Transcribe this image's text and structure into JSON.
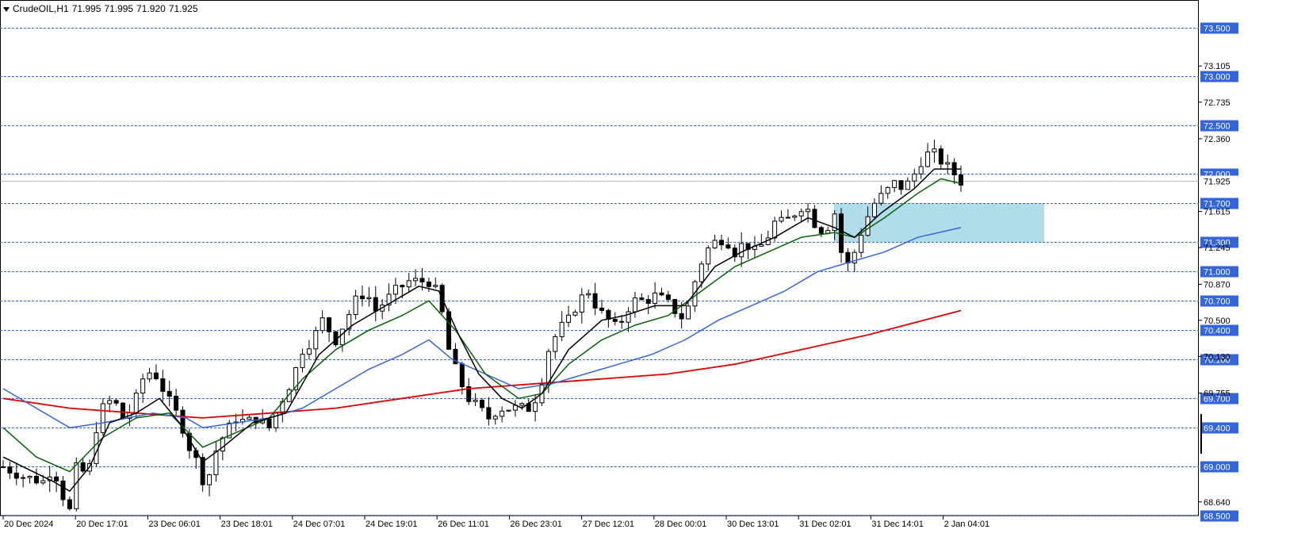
{
  "header": {
    "symbol": "CrudeOIL,H1",
    "open": "71.995",
    "high": "71.995",
    "low": "71.920",
    "close": "71.925"
  },
  "colors": {
    "ema_fast": "#000000",
    "ema_mid": "#006400",
    "ema_slow": "#3366dd",
    "ema_long": "#e00000",
    "zone": "#a8d8e8",
    "level_line": "#3366dd",
    "candle_up": "#ffffff",
    "candle_down": "#000000",
    "label_bg": "#3366dd"
  },
  "chart_data": {
    "type": "candlestick",
    "timeframe": "H1",
    "y_range": [
      68.5,
      73.7
    ],
    "y_ticks": [
      "73.105",
      "72.735",
      "72.360",
      "71.615",
      "71.245",
      "70.870",
      "70.500",
      "70.130",
      "69.755",
      "68.640"
    ],
    "level_labels": [
      "73.500",
      "73.000",
      "72.500",
      "72.000",
      "71.700",
      "71.300",
      "71.000",
      "70.700",
      "70.400",
      "70.100",
      "69.700",
      "69.400",
      "69.000",
      "68.500"
    ],
    "current_price": "71.925",
    "zone": {
      "from": 71.3,
      "to": 71.7
    },
    "x_labels": [
      "20 Dec 2024",
      "20 Dec 17:01",
      "23 Dec 06:01",
      "23 Dec 18:01",
      "24 Dec 07:01",
      "24 Dec 19:01",
      "26 Dec 11:01",
      "26 Dec 23:01",
      "27 Dec 12:01",
      "28 Dec 00:01",
      "30 Dec 13:01",
      "31 Dec 02:01",
      "31 Dec 14:01",
      "2 Jan 04:01"
    ],
    "close_path": [
      [
        0,
        69.0
      ],
      [
        6,
        68.9
      ],
      [
        12,
        68.85
      ],
      [
        15,
        69.0
      ],
      [
        18,
        68.7
      ],
      [
        20,
        68.55
      ],
      [
        23,
        69.2
      ],
      [
        25,
        68.7
      ],
      [
        27,
        69.3
      ],
      [
        30,
        69.6
      ],
      [
        33,
        69.7
      ],
      [
        36,
        69.5
      ],
      [
        39,
        69.6
      ],
      [
        42,
        69.9
      ],
      [
        45,
        70.0
      ],
      [
        48,
        69.8
      ],
      [
        51,
        69.6
      ],
      [
        53,
        69.5
      ],
      [
        56,
        69.2
      ],
      [
        59,
        69.0
      ],
      [
        61,
        68.75
      ],
      [
        63,
        69.1
      ],
      [
        66,
        69.3
      ],
      [
        70,
        69.5
      ],
      [
        73,
        69.45
      ],
      [
        76,
        69.5
      ],
      [
        80,
        69.4
      ],
      [
        84,
        69.7
      ],
      [
        87,
        69.9
      ],
      [
        90,
        70.2
      ],
      [
        93,
        70.3
      ],
      [
        96,
        70.5
      ],
      [
        100,
        70.3
      ],
      [
        103,
        70.5
      ],
      [
        106,
        70.7
      ],
      [
        109,
        70.8
      ],
      [
        112,
        70.6
      ],
      [
        115,
        70.7
      ],
      [
        118,
        70.8
      ],
      [
        122,
        70.9
      ],
      [
        125,
        70.9
      ],
      [
        128,
        70.9
      ],
      [
        131,
        70.75
      ],
      [
        134,
        70.2
      ],
      [
        137,
        69.9
      ],
      [
        140,
        69.7
      ],
      [
        143,
        69.6
      ],
      [
        146,
        69.5
      ],
      [
        149,
        69.6
      ],
      [
        152,
        69.6
      ],
      [
        155,
        69.6
      ],
      [
        158,
        69.6
      ],
      [
        161,
        69.75
      ],
      [
        164,
        70.2
      ],
      [
        167,
        70.4
      ],
      [
        170,
        70.5
      ],
      [
        173,
        70.7
      ],
      [
        176,
        70.8
      ],
      [
        179,
        70.6
      ],
      [
        182,
        70.5
      ],
      [
        185,
        70.4
      ],
      [
        187,
        70.6
      ],
      [
        190,
        70.7
      ],
      [
        193,
        70.7
      ],
      [
        196,
        70.75
      ],
      [
        199,
        70.7
      ],
      [
        202,
        70.6
      ],
      [
        205,
        70.5
      ],
      [
        208,
        70.9
      ],
      [
        211,
        71.2
      ],
      [
        214,
        71.3
      ],
      [
        217,
        71.35
      ],
      [
        220,
        71.2
      ],
      [
        223,
        71.3
      ],
      [
        226,
        71.2
      ],
      [
        229,
        71.3
      ],
      [
        232,
        71.5
      ],
      [
        235,
        71.5
      ],
      [
        238,
        71.6
      ],
      [
        241,
        71.7
      ],
      [
        244,
        71.5
      ],
      [
        247,
        71.4
      ],
      [
        250,
        71.6
      ],
      [
        253,
        71.0
      ],
      [
        256,
        71.2
      ],
      [
        259,
        71.5
      ],
      [
        262,
        71.7
      ],
      [
        265,
        71.8
      ],
      [
        268,
        71.9
      ],
      [
        271,
        71.85
      ],
      [
        274,
        72.0
      ],
      [
        277,
        72.2
      ],
      [
        280,
        72.2
      ],
      [
        283,
        72.1
      ],
      [
        286,
        72.0
      ],
      [
        288,
        71.925
      ]
    ],
    "ema_fast": [
      [
        0,
        69.1
      ],
      [
        15,
        68.85
      ],
      [
        20,
        68.75
      ],
      [
        26,
        69.0
      ],
      [
        32,
        69.45
      ],
      [
        40,
        69.55
      ],
      [
        47,
        69.7
      ],
      [
        53,
        69.45
      ],
      [
        60,
        69.05
      ],
      [
        66,
        69.2
      ],
      [
        75,
        69.45
      ],
      [
        85,
        69.55
      ],
      [
        95,
        70.15
      ],
      [
        105,
        70.45
      ],
      [
        115,
        70.65
      ],
      [
        125,
        70.85
      ],
      [
        131,
        70.8
      ],
      [
        137,
        70.35
      ],
      [
        143,
        69.95
      ],
      [
        150,
        69.7
      ],
      [
        156,
        69.6
      ],
      [
        162,
        69.75
      ],
      [
        170,
        70.2
      ],
      [
        180,
        70.5
      ],
      [
        187,
        70.55
      ],
      [
        196,
        70.65
      ],
      [
        205,
        70.65
      ],
      [
        214,
        71.05
      ],
      [
        222,
        71.2
      ],
      [
        232,
        71.35
      ],
      [
        242,
        71.55
      ],
      [
        250,
        71.45
      ],
      [
        256,
        71.35
      ],
      [
        264,
        71.6
      ],
      [
        274,
        71.85
      ],
      [
        280,
        72.05
      ],
      [
        288,
        72.05
      ]
    ],
    "ema_mid": [
      [
        0,
        69.4
      ],
      [
        10,
        69.1
      ],
      [
        20,
        68.95
      ],
      [
        30,
        69.3
      ],
      [
        40,
        69.5
      ],
      [
        50,
        69.55
      ],
      [
        60,
        69.2
      ],
      [
        70,
        69.35
      ],
      [
        80,
        69.5
      ],
      [
        90,
        69.9
      ],
      [
        100,
        70.2
      ],
      [
        110,
        70.4
      ],
      [
        120,
        70.55
      ],
      [
        128,
        70.7
      ],
      [
        136,
        70.4
      ],
      [
        145,
        69.95
      ],
      [
        155,
        69.7
      ],
      [
        162,
        69.75
      ],
      [
        170,
        70.05
      ],
      [
        180,
        70.3
      ],
      [
        190,
        70.45
      ],
      [
        200,
        70.55
      ],
      [
        210,
        70.8
      ],
      [
        220,
        71.05
      ],
      [
        230,
        71.2
      ],
      [
        240,
        71.35
      ],
      [
        250,
        71.4
      ],
      [
        256,
        71.35
      ],
      [
        265,
        71.55
      ],
      [
        275,
        71.8
      ],
      [
        282,
        71.95
      ],
      [
        288,
        71.9
      ]
    ],
    "ema_slow": [
      [
        0,
        69.8
      ],
      [
        10,
        69.6
      ],
      [
        20,
        69.4
      ],
      [
        30,
        69.45
      ],
      [
        45,
        69.55
      ],
      [
        55,
        69.5
      ],
      [
        60,
        69.4
      ],
      [
        70,
        69.45
      ],
      [
        80,
        69.5
      ],
      [
        90,
        69.6
      ],
      [
        100,
        69.8
      ],
      [
        110,
        70.0
      ],
      [
        120,
        70.15
      ],
      [
        128,
        70.3
      ],
      [
        135,
        70.1
      ],
      [
        145,
        69.95
      ],
      [
        155,
        69.8
      ],
      [
        165,
        69.85
      ],
      [
        175,
        69.95
      ],
      [
        185,
        70.05
      ],
      [
        195,
        70.15
      ],
      [
        205,
        70.3
      ],
      [
        215,
        70.5
      ],
      [
        225,
        70.65
      ],
      [
        235,
        70.8
      ],
      [
        245,
        71.0
      ],
      [
        255,
        71.1
      ],
      [
        265,
        71.2
      ],
      [
        275,
        71.35
      ],
      [
        288,
        71.45
      ]
    ],
    "ema_long": [
      [
        0,
        69.7
      ],
      [
        20,
        69.6
      ],
      [
        40,
        69.55
      ],
      [
        60,
        69.5
      ],
      [
        80,
        69.55
      ],
      [
        100,
        69.6
      ],
      [
        120,
        69.7
      ],
      [
        140,
        69.8
      ],
      [
        160,
        69.85
      ],
      [
        180,
        69.9
      ],
      [
        200,
        69.95
      ],
      [
        220,
        70.05
      ],
      [
        240,
        70.2
      ],
      [
        260,
        70.35
      ],
      [
        288,
        70.6
      ]
    ]
  }
}
